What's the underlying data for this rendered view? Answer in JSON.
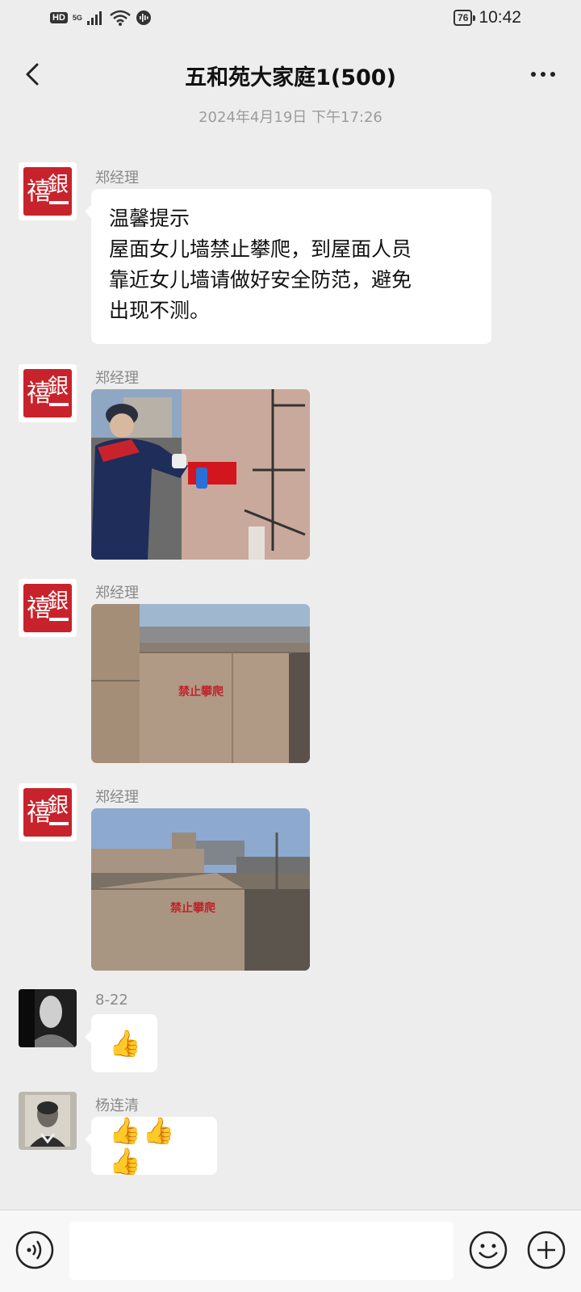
{
  "status_bar": {
    "hd": "HD",
    "network": "5G",
    "battery": "76",
    "time": "10:42"
  },
  "header": {
    "title": "五和苑大家庭1(500)",
    "back_icon": "chevron-left-icon",
    "more_icon": "more-dots-icon"
  },
  "timestamp": "2024年4月19日 下午17:26",
  "messages": [
    {
      "sender": "郑经理",
      "type": "text",
      "text": "温馨提示\n屋面女儿墙禁止攀爬，到屋面人员\n靠近女儿墙请做好安全防范，避免\n出现不测。"
    },
    {
      "sender": "郑经理",
      "type": "image"
    },
    {
      "sender": "郑经理",
      "type": "image",
      "caption": "禁止攀爬"
    },
    {
      "sender": "郑经理",
      "type": "image",
      "caption": "禁止攀爬"
    },
    {
      "sender": "8-22",
      "type": "emoji",
      "emoji": "👍"
    },
    {
      "sender": "杨连清",
      "type": "emoji",
      "emoji": "👍👍👍"
    }
  ],
  "input_bar": {
    "voice_icon": "voice-icon",
    "emoji_icon": "smiley-icon",
    "plus_icon": "plus-circle-icon",
    "placeholder": ""
  }
}
